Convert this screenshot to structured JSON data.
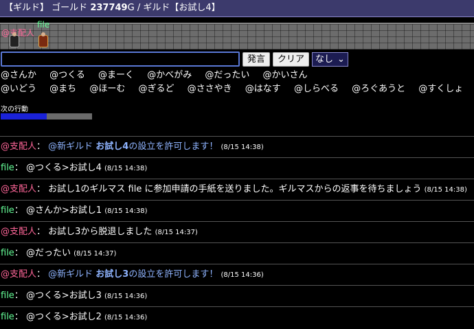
{
  "header": {
    "prefix": "【ギルド】",
    "gold_label": "ゴールド",
    "gold_value": "237749",
    "gold_unit": "G",
    "guild_part": "/ ギルド【お試し4】"
  },
  "map": {
    "char1": "@支配人",
    "char2": "file"
  },
  "input": {
    "value": "",
    "speak_button": "発言",
    "clear_button": "クリア",
    "select_value": "なし"
  },
  "commands": {
    "row1": [
      "@さんか",
      "@つくる",
      "@まーく",
      "@かべがみ",
      "@だったい",
      "@かいさん"
    ],
    "row2": [
      "@いどう",
      "@まち",
      "@ほーむ",
      "@ぎるど",
      "@ささやき",
      "@はなす",
      "@しらべる",
      "@ろぐあうと",
      "@すくしょ"
    ]
  },
  "next_action": {
    "label": "次の行動",
    "progress": 0.5
  },
  "log": [
    {
      "speaker": "@支配人",
      "type": "admin",
      "parts": [
        {
          "t": "@新ギルド ",
          "c": "blue"
        },
        {
          "t": "お試し4",
          "c": "blue-bold"
        },
        {
          "t": "の設立を許可します！",
          "c": "blue"
        }
      ],
      "time": "(8/15 14:38)"
    },
    {
      "speaker": "file",
      "type": "file",
      "parts": [
        {
          "t": "@つくる>お試し4",
          "c": ""
        }
      ],
      "time": "(8/15 14:38)"
    },
    {
      "speaker": "@支配人",
      "type": "admin",
      "parts": [
        {
          "t": "お試し1のギルマス file に参加申請の手紙を送りました。ギルマスからの返事を待ちましょう",
          "c": ""
        }
      ],
      "time": "(8/15 14:38)"
    },
    {
      "speaker": "file",
      "type": "file",
      "parts": [
        {
          "t": "@さんか>お試し1",
          "c": ""
        }
      ],
      "time": "(8/15 14:38)"
    },
    {
      "speaker": "@支配人",
      "type": "admin",
      "parts": [
        {
          "t": "お試し3から脱退しました",
          "c": ""
        }
      ],
      "time": "(8/15 14:37)"
    },
    {
      "speaker": "file",
      "type": "file",
      "parts": [
        {
          "t": "@だったい",
          "c": ""
        }
      ],
      "time": "(8/15 14:37)"
    },
    {
      "speaker": "@支配人",
      "type": "admin",
      "parts": [
        {
          "t": "@新ギルド ",
          "c": "blue"
        },
        {
          "t": "お試し3",
          "c": "blue-bold"
        },
        {
          "t": "の設立を許可します！",
          "c": "blue"
        }
      ],
      "time": "(8/15 14:36)"
    },
    {
      "speaker": "file",
      "type": "file",
      "parts": [
        {
          "t": "@つくる>お試し3",
          "c": ""
        }
      ],
      "time": "(8/15 14:36)"
    },
    {
      "speaker": "file",
      "type": "file",
      "parts": [
        {
          "t": "@つくる>お試し2",
          "c": ""
        }
      ],
      "time": "(8/15 14:36)"
    }
  ]
}
